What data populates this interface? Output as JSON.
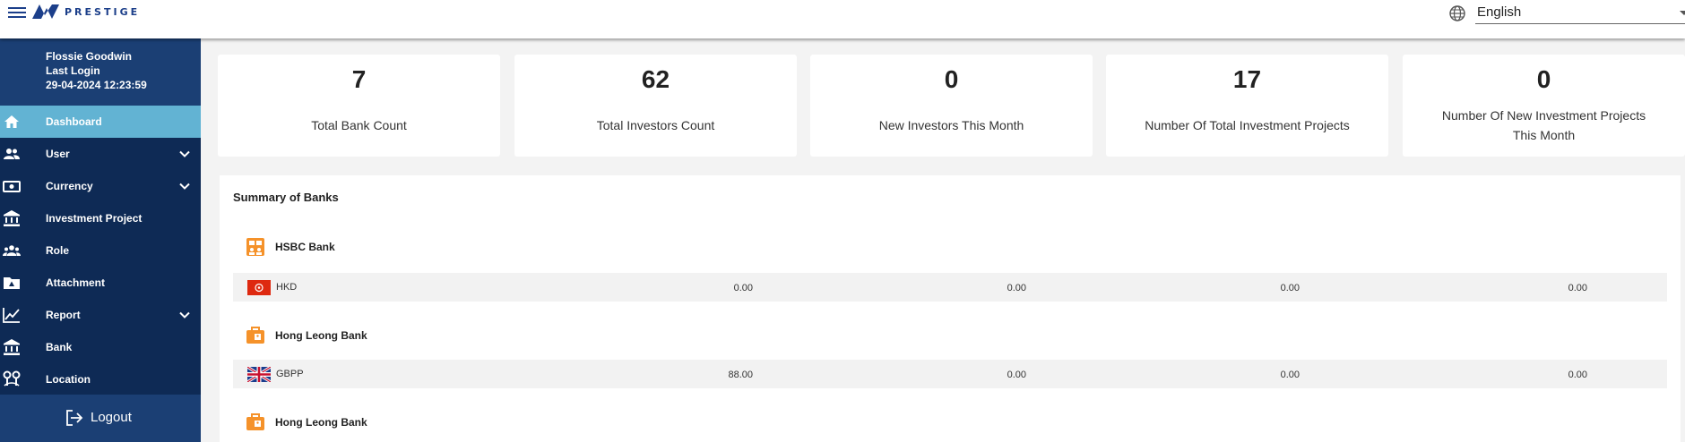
{
  "brand": {
    "name": "PRESTIGE"
  },
  "language": {
    "selected": "English"
  },
  "profile": {
    "name": "Flossie Goodwin",
    "last_login_label": "Last Login",
    "last_login": "29-04-2024 12:23:59"
  },
  "nav": [
    {
      "label": "Dashboard",
      "icon": "home-icon",
      "active": true
    },
    {
      "label": "User",
      "icon": "users-icon",
      "expandable": true
    },
    {
      "label": "Currency",
      "icon": "cash-icon",
      "expandable": true
    },
    {
      "label": "Investment Project",
      "icon": "bank-icon"
    },
    {
      "label": "Role",
      "icon": "group-icon"
    },
    {
      "label": "Attachment",
      "icon": "folder-icon"
    },
    {
      "label": "Report",
      "icon": "chart-icon",
      "expandable": true
    },
    {
      "label": "Bank",
      "icon": "bank-icon"
    },
    {
      "label": "Location",
      "icon": "location-icon"
    }
  ],
  "logout": {
    "label": "Logout"
  },
  "stats": [
    {
      "value": "7",
      "label": "Total Bank Count"
    },
    {
      "value": "62",
      "label": "Total Investors Count"
    },
    {
      "value": "0",
      "label": "New Investors This Month"
    },
    {
      "value": "17",
      "label": "Number Of Total Investment Projects"
    },
    {
      "value": "0",
      "label": "Number Of New Investment Projects This Month"
    }
  ],
  "summary": {
    "title": "Summary of Banks",
    "banks": [
      {
        "name": "HSBC Bank",
        "rows": [
          {
            "currency": "HKD",
            "flag": "hong-kong-flag",
            "values": [
              "0.00",
              "0.00",
              "0.00",
              "0.00"
            ]
          }
        ]
      },
      {
        "name": "Hong Leong Bank",
        "rows": [
          {
            "currency": "GBPP",
            "flag": "uk-flag",
            "values": [
              "88.00",
              "0.00",
              "0.00",
              "0.00"
            ]
          }
        ]
      },
      {
        "name": "Hong Leong Bank",
        "rows": []
      }
    ]
  },
  "colors": {
    "sidebar": "#0e2a55",
    "sidebar_active": "#62b3d3",
    "brand": "#1c3f8a",
    "bank_icon": "#f5922a"
  }
}
